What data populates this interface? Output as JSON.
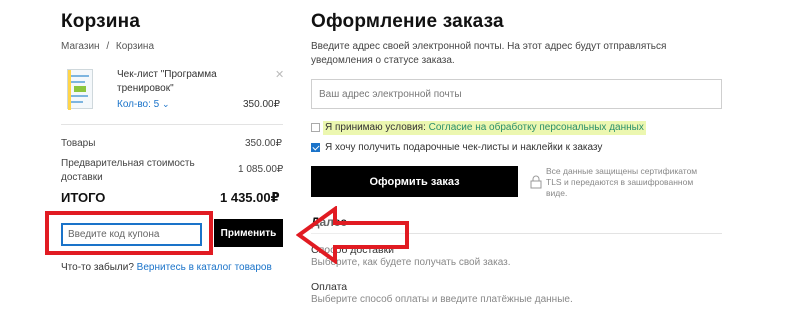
{
  "cart": {
    "title": "Корзина",
    "breadcrumb": {
      "shop": "Магазин",
      "sep": "/",
      "current": "Корзина"
    },
    "item": {
      "name_line1": "Чек-лист \"Программа",
      "name_line2": "тренировок\"",
      "qty": "Кол-во: 5",
      "price": "350.00₽"
    },
    "goods_label": "Товары",
    "goods_value": "350.00₽",
    "prelim_label_1": "Предварительная стоимость",
    "prelim_label_2": "доставки",
    "prelim_value": "1 085.00₽",
    "total_label": "ИТОГО",
    "total_value": "1 435.00₽",
    "coupon_placeholder": "Введите код купона",
    "apply_label": "Применить",
    "forgot_text": "Что-то забыли?",
    "back_link": "Вернитесь в каталог товаров"
  },
  "checkout": {
    "title": "Оформление заказа",
    "intro_1": "Введите адрес своей электронной почты. На этот адрес будут отправляться",
    "intro_2": "уведомления о статусе заказа.",
    "email_placeholder": "Ваш адрес электронной почты",
    "terms_text": "Я принимаю условия:",
    "terms_link": "Согласие на обработку персональных данных",
    "newsletter_text": "Я хочу получить подарочные чек-листы и наклейки к заказу",
    "submit_label": "Оформить заказ",
    "secure_1": "Все данные защищены сертификатом",
    "secure_2": "TLS и передаются в зашифрованном",
    "secure_3": "виде.",
    "next_title": "Далее",
    "delivery_title": "Способ доставки",
    "delivery_desc": "Выберите, как будете получать свой заказ.",
    "payment_title": "Оплата",
    "payment_desc": "Выберите способ оплаты и введите платёжные данные."
  },
  "colors": {
    "accent": "#1a73c9",
    "highlight": "#ecf7b0",
    "annotation": "#e11b22"
  }
}
